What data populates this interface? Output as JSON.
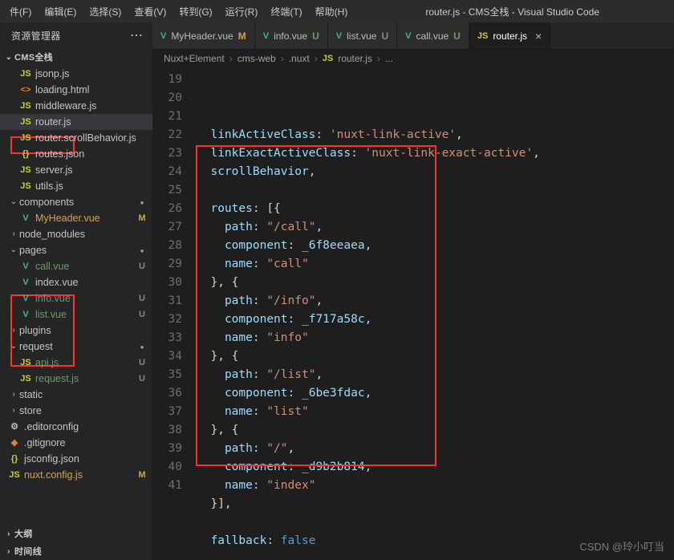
{
  "window": {
    "title": "router.js - CMS全栈 - Visual Studio Code"
  },
  "menu": {
    "file": "件(F)",
    "edit": "编辑(E)",
    "select": "选择(S)",
    "view": "查看(V)",
    "goto": "转到(G)",
    "run": "运行(R)",
    "terminal": "终端(T)",
    "help": "帮助(H)"
  },
  "sidebar": {
    "title": "资源管理器",
    "project": "CMS全栈",
    "outline": "大纲",
    "timeline": "时间线"
  },
  "tree": [
    {
      "indent": 24,
      "icon": "JS",
      "iconClass": "js",
      "label": "jsonp.js"
    },
    {
      "indent": 24,
      "icon": "<>",
      "iconClass": "html",
      "label": "loading.html"
    },
    {
      "indent": 24,
      "icon": "JS",
      "iconClass": "js",
      "label": "middleware.js"
    },
    {
      "indent": 24,
      "icon": "JS",
      "iconClass": "js",
      "label": "router.js",
      "selected": true
    },
    {
      "indent": 24,
      "icon": "JS",
      "iconClass": "js",
      "label": "router.scrollBehavior.js"
    },
    {
      "indent": 24,
      "icon": "{}",
      "iconClass": "json",
      "label": "routes.json"
    },
    {
      "indent": 24,
      "icon": "JS",
      "iconClass": "js",
      "label": "server.js"
    },
    {
      "indent": 24,
      "icon": "JS",
      "iconClass": "js",
      "label": "utils.js"
    },
    {
      "indent": 10,
      "chev": "⌄",
      "label": "components",
      "folder": true,
      "status": "dot"
    },
    {
      "indent": 24,
      "icon": "V",
      "iconClass": "vue",
      "label": "MyHeader.vue",
      "labelClass": "yellow",
      "status": "M"
    },
    {
      "indent": 10,
      "chev": "›",
      "label": "node_modules",
      "folder": true
    },
    {
      "indent": 10,
      "chev": "⌄",
      "label": "pages",
      "folder": true,
      "status": "dot"
    },
    {
      "indent": 24,
      "icon": "V",
      "iconClass": "vue",
      "label": "call.vue",
      "labelClass": "green",
      "status": "U"
    },
    {
      "indent": 24,
      "icon": "V",
      "iconClass": "vue",
      "label": "index.vue"
    },
    {
      "indent": 24,
      "icon": "V",
      "iconClass": "vue",
      "label": "info.vue",
      "labelClass": "green",
      "status": "U"
    },
    {
      "indent": 24,
      "icon": "V",
      "iconClass": "vue",
      "label": "list.vue",
      "labelClass": "green",
      "status": "U"
    },
    {
      "indent": 10,
      "chev": "›",
      "label": "plugins",
      "folder": true
    },
    {
      "indent": 10,
      "chev": "⌄",
      "label": "request",
      "folder": true,
      "status": "dot"
    },
    {
      "indent": 24,
      "icon": "JS",
      "iconClass": "js",
      "label": "api.js",
      "labelClass": "green",
      "status": "U"
    },
    {
      "indent": 24,
      "icon": "JS",
      "iconClass": "js",
      "label": "request.js",
      "labelClass": "green",
      "status": "U"
    },
    {
      "indent": 10,
      "chev": "›",
      "label": "static",
      "folder": true
    },
    {
      "indent": 10,
      "chev": "›",
      "label": "store",
      "folder": true
    },
    {
      "indent": 10,
      "icon": "⚙",
      "iconClass": "conf",
      "label": ".editorconfig"
    },
    {
      "indent": 10,
      "icon": "◆",
      "iconClass": "git",
      "label": ".gitignore"
    },
    {
      "indent": 10,
      "icon": "{}",
      "iconClass": "json",
      "label": "jsconfig.json"
    },
    {
      "indent": 10,
      "icon": "JS",
      "iconClass": "js",
      "label": "nuxt.config.js",
      "labelClass": "yellow",
      "status": "M"
    }
  ],
  "tabs": [
    {
      "icon": "V",
      "iconClass": "vue",
      "label": "MyHeader.vue",
      "status": "M",
      "statusClass": "M"
    },
    {
      "icon": "V",
      "iconClass": "vue",
      "label": "info.vue",
      "status": "U",
      "statusClass": "U"
    },
    {
      "icon": "V",
      "iconClass": "vue",
      "label": "list.vue",
      "status": "U",
      "statusClass": "U"
    },
    {
      "icon": "V",
      "iconClass": "vue",
      "label": "call.vue",
      "status": "U",
      "statusClass": "U"
    },
    {
      "icon": "JS",
      "iconClass": "js",
      "label": "router.js",
      "status": "×",
      "active": true,
      "closable": true
    }
  ],
  "breadcrumb": {
    "parts": [
      "Nuxt+Element",
      "cms-web",
      ".nuxt"
    ],
    "fileIcon": "JS",
    "fileIconClass": "js",
    "file": "router.js",
    "tail": "..."
  },
  "code": {
    "startLine": 19,
    "lines": [
      [
        [
          "k",
          "linkActiveClass"
        ],
        [
          "p",
          ": "
        ],
        [
          "s",
          "'nuxt-link-active'"
        ],
        [
          "p",
          ","
        ]
      ],
      [
        [
          "k",
          "linkExactActiveClass"
        ],
        [
          "p",
          ": "
        ],
        [
          "s",
          "'nuxt-link-exact-active'"
        ],
        [
          "p",
          ","
        ]
      ],
      [
        [
          "k",
          "scrollBehavior"
        ],
        [
          "p",
          ","
        ]
      ],
      [],
      [
        [
          "k",
          "routes"
        ],
        [
          "p",
          ": [{"
        ]
      ],
      [
        [
          "p",
          "  "
        ],
        [
          "k",
          "path"
        ],
        [
          "p",
          ": "
        ],
        [
          "s",
          "\"/call\""
        ],
        [
          "p",
          ","
        ]
      ],
      [
        [
          "p",
          "  "
        ],
        [
          "k",
          "component"
        ],
        [
          "p",
          ": "
        ],
        [
          "v",
          "_6f8eeaea"
        ],
        [
          "p",
          ","
        ]
      ],
      [
        [
          "p",
          "  "
        ],
        [
          "k",
          "name"
        ],
        [
          "p",
          ": "
        ],
        [
          "s",
          "\"call\""
        ]
      ],
      [
        [
          "p",
          "}, {"
        ]
      ],
      [
        [
          "p",
          "  "
        ],
        [
          "k",
          "path"
        ],
        [
          "p",
          ": "
        ],
        [
          "s",
          "\"/info\""
        ],
        [
          "p",
          ","
        ]
      ],
      [
        [
          "p",
          "  "
        ],
        [
          "k",
          "component"
        ],
        [
          "p",
          ": "
        ],
        [
          "v",
          "_f717a58c"
        ],
        [
          "p",
          ","
        ]
      ],
      [
        [
          "p",
          "  "
        ],
        [
          "k",
          "name"
        ],
        [
          "p",
          ": "
        ],
        [
          "s",
          "\"info\""
        ]
      ],
      [
        [
          "p",
          "}, {"
        ]
      ],
      [
        [
          "p",
          "  "
        ],
        [
          "k",
          "path"
        ],
        [
          "p",
          ": "
        ],
        [
          "s",
          "\"/list\""
        ],
        [
          "p",
          ","
        ]
      ],
      [
        [
          "p",
          "  "
        ],
        [
          "k",
          "component"
        ],
        [
          "p",
          ": "
        ],
        [
          "v",
          "_6be3fdac"
        ],
        [
          "p",
          ","
        ]
      ],
      [
        [
          "p",
          "  "
        ],
        [
          "k",
          "name"
        ],
        [
          "p",
          ": "
        ],
        [
          "s",
          "\"list\""
        ]
      ],
      [
        [
          "p",
          "}, {"
        ]
      ],
      [
        [
          "p",
          "  "
        ],
        [
          "k",
          "path"
        ],
        [
          "p",
          ": "
        ],
        [
          "s",
          "\"/\""
        ],
        [
          "p",
          ","
        ]
      ],
      [
        [
          "p",
          "  "
        ],
        [
          "k",
          "component"
        ],
        [
          "p",
          ": "
        ],
        [
          "v",
          "_d9b2b814"
        ],
        [
          "p",
          ","
        ]
      ],
      [
        [
          "p",
          "  "
        ],
        [
          "k",
          "name"
        ],
        [
          "p",
          ": "
        ],
        [
          "s",
          "\"index\""
        ]
      ],
      [
        [
          "p",
          "}],"
        ]
      ],
      [],
      [
        [
          "k",
          "fallback"
        ],
        [
          "p",
          ": "
        ],
        [
          "kw",
          "false"
        ]
      ]
    ]
  },
  "watermark": "CSDN @玲小叮当"
}
